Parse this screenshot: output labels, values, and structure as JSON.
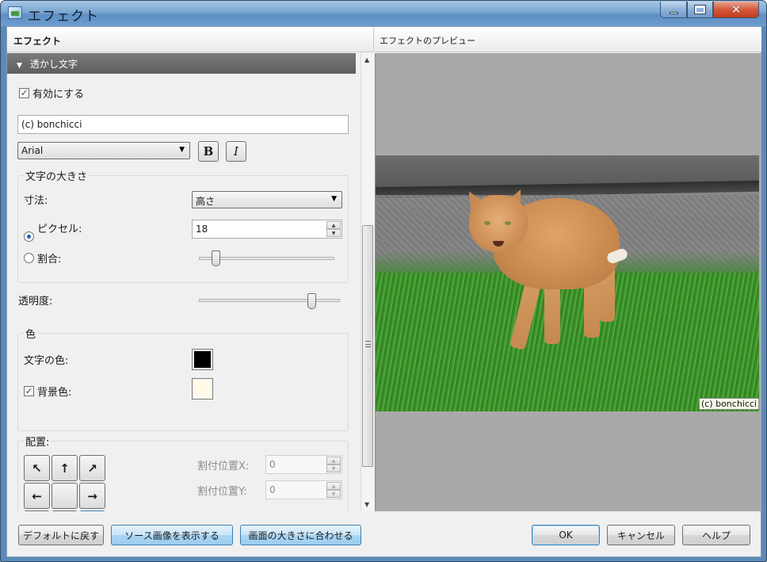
{
  "window": {
    "title": "エフェクト",
    "close_glyph": "✕"
  },
  "left_panel": {
    "header": "エフェクト",
    "section_title": "透かし文字",
    "enable_label": "有効にする",
    "enable_checked": true,
    "watermark_text": "(c) bonchicci",
    "font": {
      "selected": "Arial",
      "bold_label": "B",
      "italic_label": "I"
    },
    "size_group": {
      "title": "文字の大きさ",
      "dimension_label": "寸法:",
      "dimension_value": "高さ",
      "pixel_label": "ピクセル:",
      "pixel_value": "18",
      "pixel_selected": true,
      "ratio_label": "割合:",
      "ratio_slider_level": 0.1
    },
    "opacity": {
      "label": "透明度:",
      "slider_level": 0.82
    },
    "color_group": {
      "title": "色",
      "text_color_label": "文字の色:",
      "text_color": "#000000",
      "background_label": "背景色:",
      "background_checked": true,
      "background_color": "#fffbe8"
    },
    "placement_group": {
      "title": "配置:",
      "arrows": [
        "↖",
        "↑",
        "↗",
        "←",
        "",
        "→",
        "↙",
        "↓",
        "↘"
      ],
      "active_index": 8,
      "offset_x_label": "割付位置X:",
      "offset_x_value": "0",
      "offset_y_label": "割付位置Y:",
      "offset_y_value": "0"
    }
  },
  "right_panel": {
    "header": "エフェクトのプレビュー",
    "watermark_preview": "(c) bonchicci"
  },
  "buttons": {
    "default": "デフォルトに戻す",
    "show_source": "ソース画像を表示する",
    "fit_screen": "画面の大きさに合わせる",
    "ok": "OK",
    "cancel": "キャンセル",
    "help": "ヘルプ"
  },
  "colors": {
    "accent": "#3c7fb1",
    "section_header": "#6a6a6a",
    "preview_background": "#a9a9a9"
  }
}
